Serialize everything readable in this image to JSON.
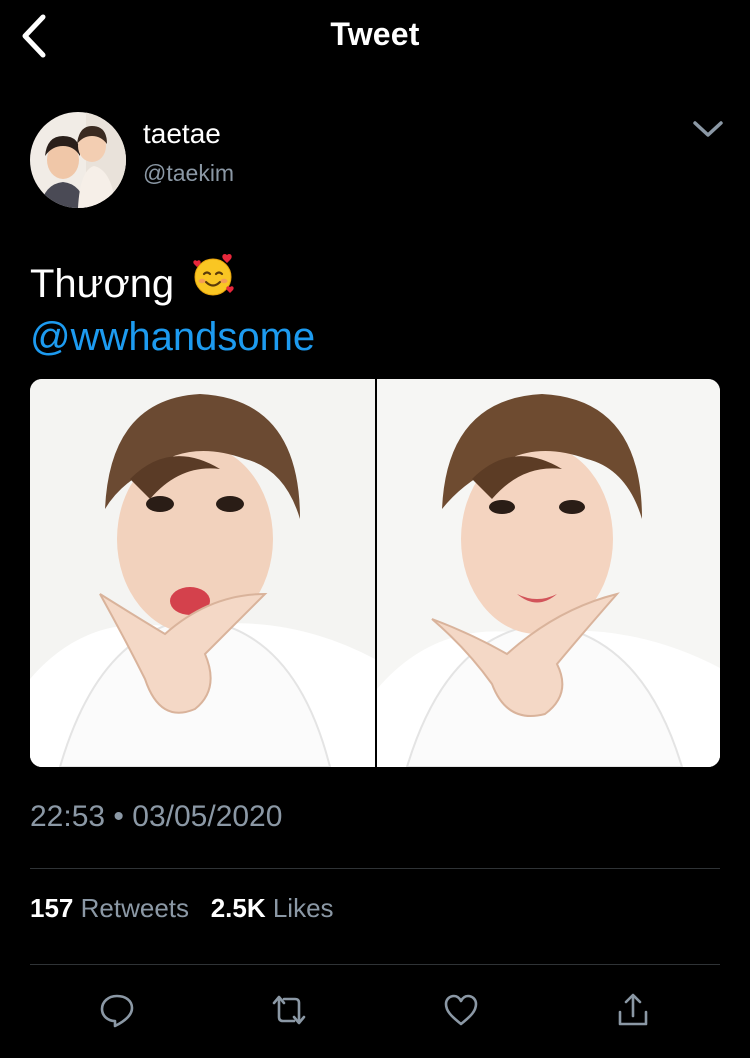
{
  "nav": {
    "title": "Tweet",
    "back_icon": "chevron-left-icon"
  },
  "author": {
    "display_name": "taetae",
    "handle": "@taekim",
    "menu_icon": "chevron-down-icon"
  },
  "tweet": {
    "text": "Thương",
    "emoji": "smiling-face-with-hearts",
    "mention": "@wwhandsome",
    "media": [
      {
        "alt": "photo-1"
      },
      {
        "alt": "photo-2"
      }
    ],
    "time": "22:53",
    "separator": "•",
    "date": "03/05/2020"
  },
  "stats": {
    "retweets_count": "157",
    "retweets_label": "Retweets",
    "likes_count": "2.5K",
    "likes_label": "Likes"
  },
  "actions": [
    "reply-icon",
    "retweet-icon",
    "like-icon",
    "share-icon"
  ],
  "colors": {
    "background": "#000000",
    "text": "#ffffff",
    "secondary": "#8b98a5",
    "link": "#1d9bf0",
    "divider": "#2f3336"
  }
}
